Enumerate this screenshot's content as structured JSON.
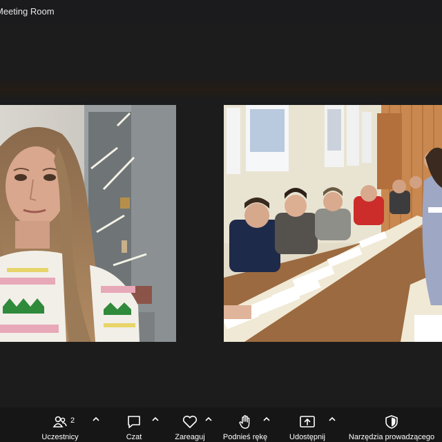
{
  "window": {
    "title": "Meeting Room"
  },
  "toolbar": {
    "participants": {
      "label": "Uczestnicy",
      "count": "2",
      "icon": "participants-icon"
    },
    "chat": {
      "label": "Czat",
      "icon": "chat-bubble-icon"
    },
    "react": {
      "label": "Zareaguj",
      "icon": "heart-icon"
    },
    "raise_hand": {
      "label": "Podnieś rękę",
      "icon": "hand-icon"
    },
    "share": {
      "label": "Udostępnij",
      "icon": "share-screen-icon"
    },
    "host_tools": {
      "label": "Narzędzia prowadzącego",
      "icon": "shield-icon"
    }
  },
  "colors": {
    "titlebar": "#1b1b1d",
    "stage": "#1c1c1c",
    "toolbar": "#161616",
    "text": "#ffffff"
  }
}
